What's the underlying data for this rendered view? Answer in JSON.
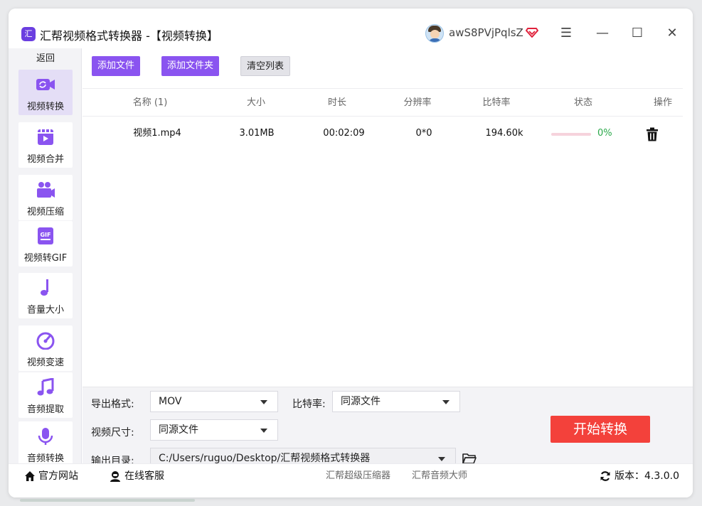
{
  "app": {
    "logo_char": "汇",
    "title": "汇帮视频格式转换器 -【视频转换】",
    "username": "awS8PVjPqlsZ"
  },
  "window_controls": {
    "menu": "☰",
    "minimize": "—",
    "maximize": "☐",
    "close": "✕"
  },
  "colors": {
    "accent": "#8a54f0",
    "active_nav": "#e4def6",
    "start_button": "#f3413b",
    "progress_track": "#f6d3dc",
    "progress_ok_text": "#2aa84a"
  },
  "sidebar": {
    "back_label": "返回",
    "items": [
      {
        "label": "视频转换",
        "icon": "video-convert-icon",
        "active": true
      },
      {
        "label": "视频合并",
        "icon": "video-merge-icon",
        "active": false
      },
      {
        "label": "视频压缩",
        "icon": "video-compress-icon",
        "active": false
      },
      {
        "label": "视频转GIF",
        "icon": "gif-icon",
        "active": false
      },
      {
        "label": "音量大小",
        "icon": "music-note-icon",
        "active": false
      },
      {
        "label": "视频变速",
        "icon": "speedometer-icon",
        "active": false
      },
      {
        "label": "音频提取",
        "icon": "audio-extract-icon",
        "active": false
      },
      {
        "label": "音频转换",
        "icon": "microphone-icon",
        "active": false
      }
    ]
  },
  "toolbar": {
    "add_file": "添加文件",
    "add_folder": "添加文件夹",
    "clear_list": "清空列表"
  },
  "table": {
    "headers": {
      "name": "名称 (1)",
      "size": "大小",
      "duration": "时长",
      "resolution": "分辨率",
      "bitrate": "比特率",
      "status": "状态",
      "action": "操作"
    },
    "rows": [
      {
        "name": "视频1.mp4",
        "size": "3.01MB",
        "duration": "00:02:09",
        "resolution": "0*0",
        "bitrate": "194.60k",
        "progress_text": "0%",
        "progress": 0
      }
    ]
  },
  "settings": {
    "format_label": "导出格式:",
    "format_value": "MOV",
    "bitrate_label": "比特率:",
    "bitrate_value": "同源文件",
    "size_label": "视频尺寸:",
    "size_value": "同源文件",
    "output_label": "输出目录:",
    "output_value": "C:/Users/ruguo/Desktop/汇帮视频格式转换器",
    "start_label": "开始转换"
  },
  "footer": {
    "website": "官方网站",
    "support": "在线客服",
    "link1": "汇帮超级压缩器",
    "link2": "汇帮音频大师",
    "version": "版本：4.3.0.0"
  }
}
